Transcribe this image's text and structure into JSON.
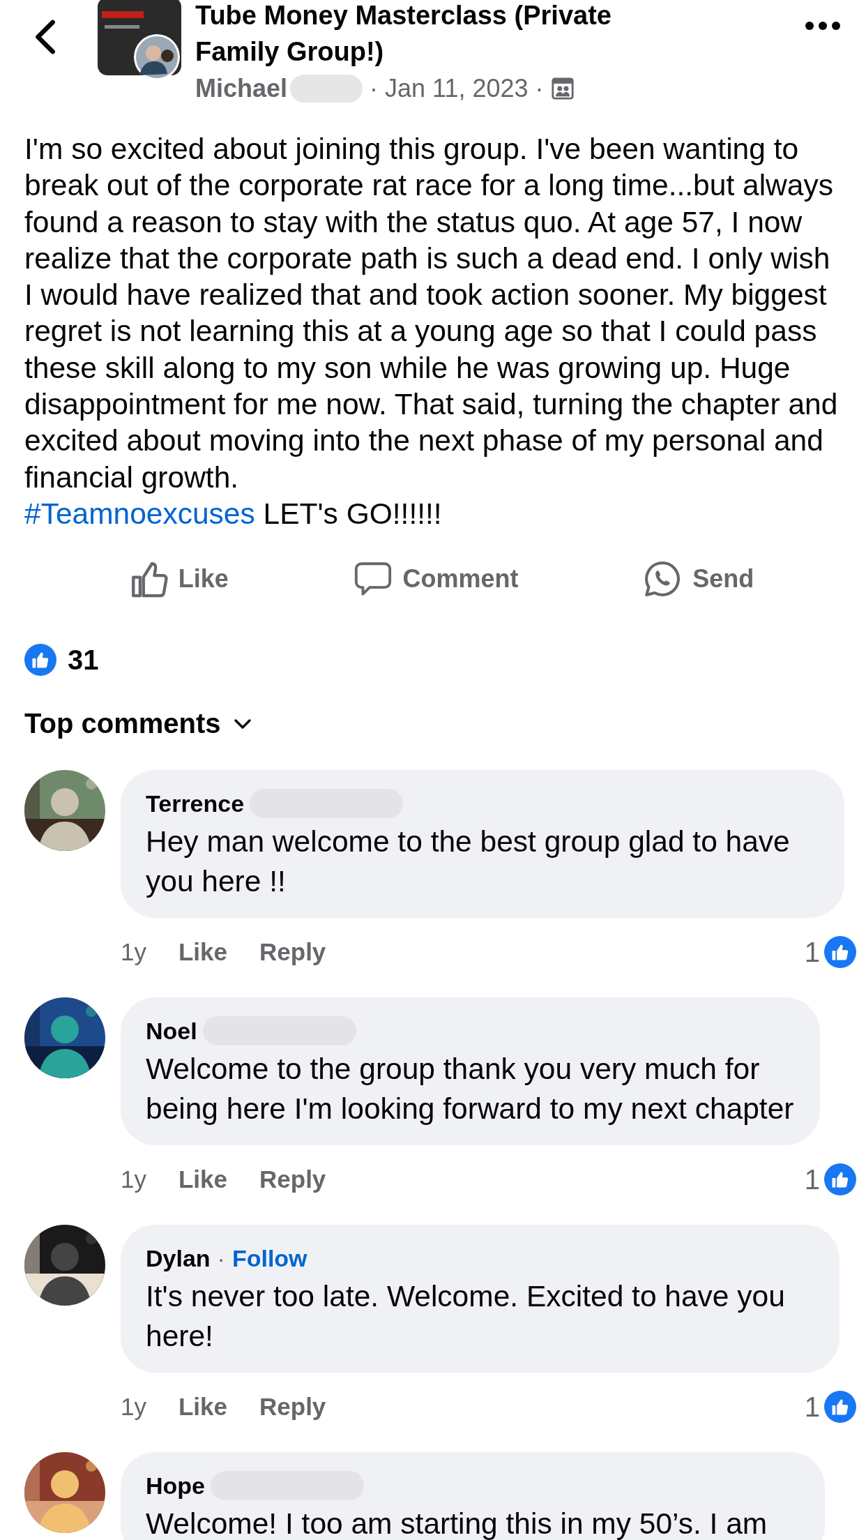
{
  "header": {
    "group_title": "Tube Money Masterclass (Private Family Group!)",
    "author": "Michael",
    "separator_1": "·",
    "date": "Jan 11, 2023",
    "separator_2": "·"
  },
  "post": {
    "text": "I'm so excited about joining this group. I've been wanting to break out of the corporate rat race for a long time...but always found a reason to stay with the status quo. At age 57, I now realize that the corporate path is such a dead end. I only wish I would have realized that and took action sooner. My biggest regret is not learning this at a young age so that I could pass these skill along to my son while he was growing up. Huge disappointment for me now. That said, turning the chapter and excited about moving into the next phase of my personal and financial growth.",
    "hashtag": "#Teamnoexcuses",
    "tail": " LET's GO!!!!!!"
  },
  "actions": [
    {
      "kind": "like",
      "label": "Like"
    },
    {
      "kind": "comment",
      "label": "Comment"
    },
    {
      "kind": "send",
      "label": "Send"
    }
  ],
  "reactions": {
    "count": "31"
  },
  "sort": {
    "label": "Top comments"
  },
  "comments": [
    {
      "name": "Terrence",
      "text": "Hey man welcome to the best group glad to have you here !!",
      "time": "1y",
      "like": "Like",
      "reply": "Reply",
      "likes": "1"
    },
    {
      "name": "Noel",
      "text": "Welcome to the group thank you very much for being here I'm looking forward to my next chapter",
      "time": "1y",
      "like": "Like",
      "reply": "Reply",
      "likes": "1"
    },
    {
      "name": "Dylan",
      "separator": "·",
      "follow": "Follow",
      "text": "It's never too late. Welcome. Excited to have you here!",
      "time": "1y",
      "like": "Like",
      "reply": "Reply",
      "likes": "1"
    },
    {
      "name": "Hope",
      "text": "Welcome! I too am starting this in my 50’s. I am"
    }
  ]
}
